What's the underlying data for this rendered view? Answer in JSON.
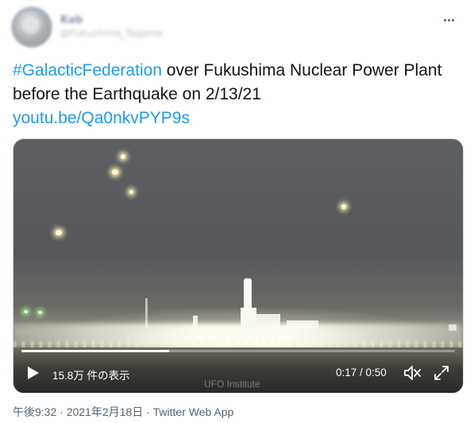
{
  "user": {
    "display_name": "Kab",
    "handle": "@Fukushima_Tagame"
  },
  "tweet": {
    "hashtag": "#GalacticFederation",
    "text_after_hashtag": " over Fukushima Nuclear Power Plant before the Earthquake on 2/13/21",
    "link": "youtu.be/Qa0nkvPYP9s"
  },
  "video": {
    "views": "15.8万 件の表示",
    "time": "0:17 / 0:50",
    "progress": 0.34,
    "watermark": "UFO Institute"
  },
  "footer": {
    "timestamp": "午後9:32 · 2021年2月18日",
    "separator": " · ",
    "app": "Twitter Web App"
  },
  "icons": {
    "more": "more-horizontal-icon",
    "play": "play-icon",
    "mute": "muted-speaker-icon",
    "fullscreen": "expand-icon"
  },
  "colors": {
    "link": "#1d9bf0",
    "text": "#0f1419",
    "muted": "#536471"
  }
}
